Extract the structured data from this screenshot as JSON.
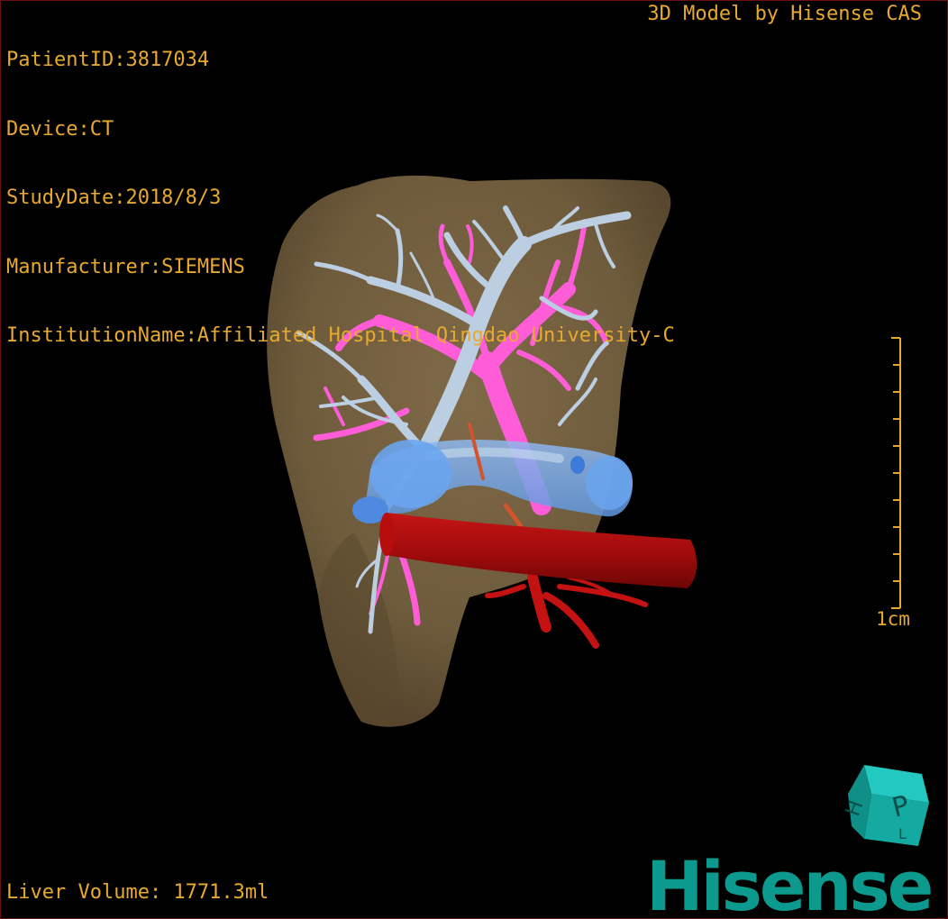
{
  "info": {
    "patient_id_line": "PatientID:3817034",
    "device_line": "Device:CT",
    "study_date_line": "StudyDate:2018/8/3",
    "manufacturer_line": "Manufacturer:SIEMENS",
    "institution_line": "InstitutionName:Affiliated Hospital Qingdao University-C"
  },
  "brand": {
    "title": "3D Model by Hisense CAS",
    "logo_text": "Hisense"
  },
  "scale_bar": {
    "label": "1cm"
  },
  "liver_volume": "Liver Volume: 1771.3ml",
  "orientation_cube": {
    "face_letters": [
      "H",
      "P",
      "L"
    ],
    "icon": "orientation-cube-icon"
  },
  "colors": {
    "overlay_text": "#e7a92e",
    "liver": "#7a6140",
    "hepatic_vein": "#b9cde0",
    "portal_vein": "#ff5cd8",
    "ivc": "#6fa8ef",
    "aorta": "#a30b0b",
    "brand": "#0d9a8e"
  }
}
